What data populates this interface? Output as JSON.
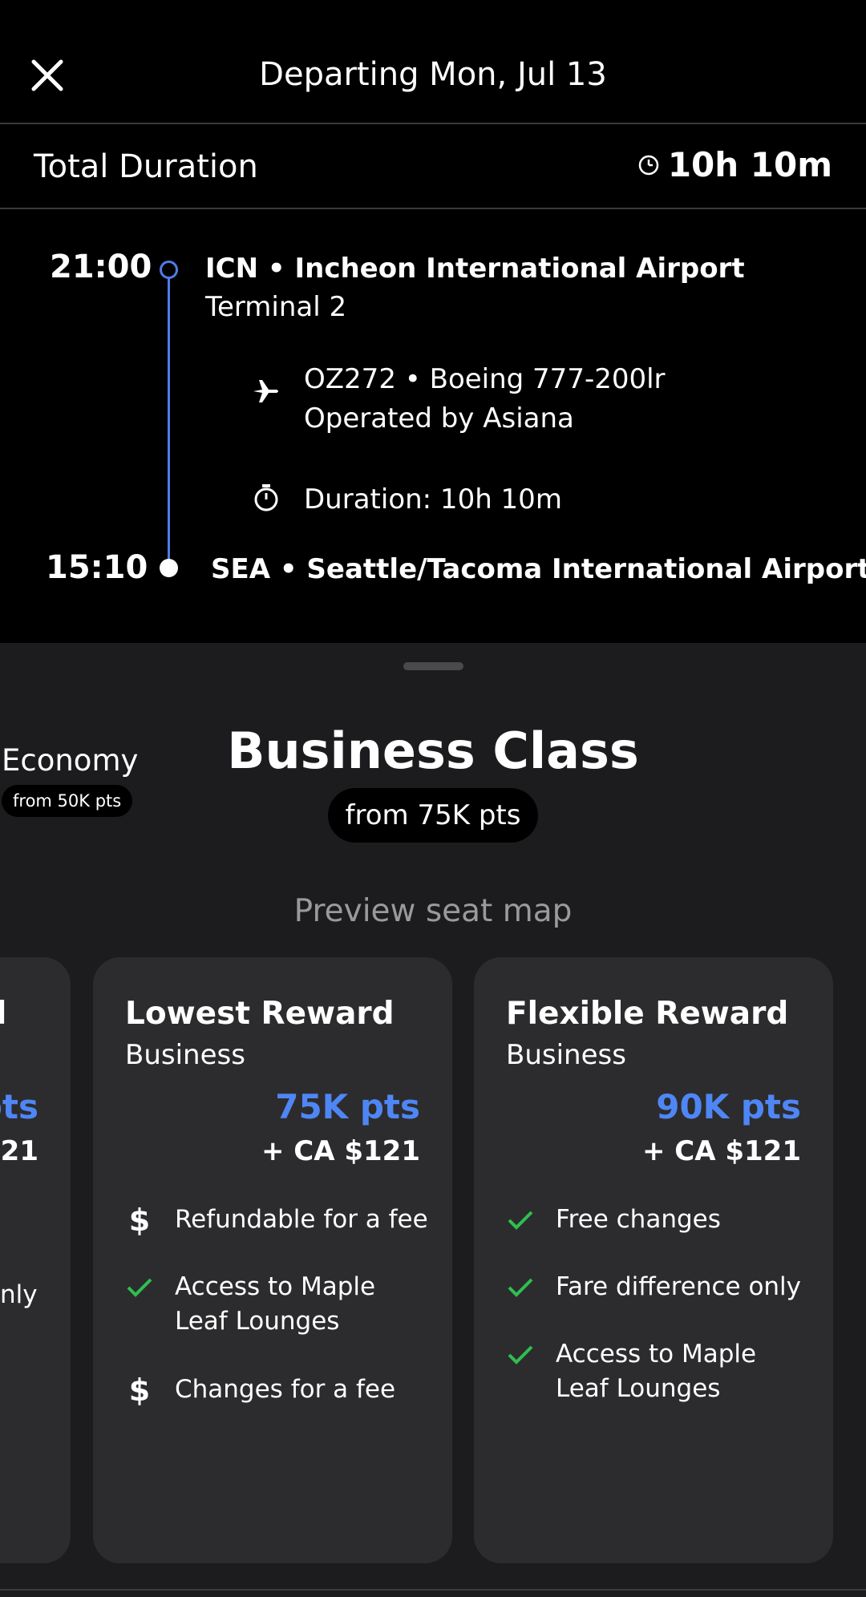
{
  "header": {
    "title": "Departing Mon, Jul 13",
    "close_icon": "close-icon"
  },
  "duration": {
    "label": "Total Duration",
    "value": "10h 10m"
  },
  "itinerary": {
    "departure": {
      "time": "21:00",
      "airport": "ICN • Incheon International Airport",
      "terminal": "Terminal 2"
    },
    "segment": {
      "flight": "OZ272 • Boeing 777-200lr",
      "operated_by": "Operated by Asiana",
      "duration": "Duration: 10h 10m"
    },
    "arrival": {
      "time": "15:10",
      "airport": "SEA • Seattle/Tacoma International Airport"
    },
    "line_color": "#4f7ce8"
  },
  "cabins": {
    "economy": {
      "label": "Economy",
      "price": "from 50K pts"
    },
    "business": {
      "label": "Business Class",
      "price": "from 75K pts"
    },
    "preview_link": "Preview seat map"
  },
  "fares": {
    "left_partial": {
      "title": "l",
      "pts": "pts",
      "tax": "121",
      "feature": "nly"
    },
    "lowest": {
      "title": "Lowest Reward",
      "cabin": "Business",
      "pts": "75K pts",
      "tax": "+ CA $121",
      "features": [
        {
          "icon": "dollar-icon",
          "text": "Refundable for a fee"
        },
        {
          "icon": "check-icon",
          "text": "Access to Maple Leaf Lounges"
        },
        {
          "icon": "dollar-icon",
          "text": "Changes for a fee"
        }
      ]
    },
    "flexible": {
      "title": "Flexible Reward",
      "cabin": "Business",
      "pts": "90K pts",
      "tax": "+ CA $121",
      "features": [
        {
          "icon": "check-icon",
          "text": "Free changes"
        },
        {
          "icon": "check-icon",
          "text": "Fare difference only"
        },
        {
          "icon": "check-icon",
          "text": "Access to Maple Leaf Lounges"
        }
      ]
    }
  },
  "colors": {
    "accent": "#4f86f5",
    "check": "#2fbf4f",
    "sheet_bg": "#1c1c1e",
    "card_bg": "#2c2c2e"
  }
}
